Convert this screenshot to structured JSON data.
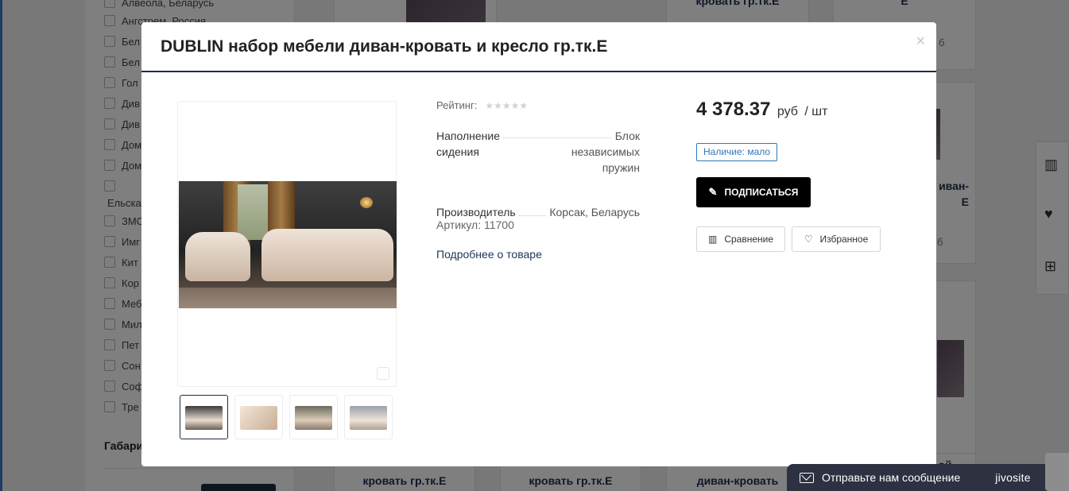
{
  "background": {
    "filters": [
      {
        "label": "Алвеола, Беларусь"
      },
      {
        "label": "Ангстрем, Россия"
      },
      {
        "label": "Бел"
      },
      {
        "label": "Бел"
      },
      {
        "label": "Гол"
      },
      {
        "label": "Див"
      },
      {
        "label": "Див"
      },
      {
        "label": "Дом"
      },
      {
        "label": "Дом"
      },
      {
        "label": ""
      },
      {
        "label": "ЗМС"
      },
      {
        "label": "Имг"
      },
      {
        "label": "Кит"
      },
      {
        "label": "Кор"
      },
      {
        "label": "Меб"
      },
      {
        "label": "Мил"
      },
      {
        "label": "Пет"
      },
      {
        "label": "Сон"
      },
      {
        "label": "Соф"
      },
      {
        "label": "Тре"
      }
    ],
    "filter_plain": "Ельска",
    "section_title": "Габари",
    "cards": {
      "top_title_1": "кровать гр.тк.Е",
      "top_title_2": "Е",
      "top_price_1": "б",
      "right_title": "иван-\nЕ",
      "right_price": "б",
      "bottom_title_1": "кровать гр.тк.Е",
      "bottom_title_2": "кровать гр.тк.Е",
      "bottom_title_3": "диван-кровать",
      "bottom_title_4": "ой"
    }
  },
  "modal": {
    "title": "DUBLIN набор мебели диван-кровать и кресло гр.тк.Е",
    "close": "×",
    "rating_label": "Рейтинг:",
    "rating_stars": "★★★★★",
    "rating_value": 0,
    "properties": {
      "filling_name": "Наполнение сидения",
      "filling_value": "Блок независимых пружин",
      "manufacturer_name": "Производитель",
      "manufacturer_value": "Корсак, Беларусь"
    },
    "article": "Артикул: 11700",
    "more_link": "Подробнее о товаре",
    "price": {
      "amount": "4 378.37",
      "currency": "руб",
      "unit": "/ шт"
    },
    "stock": "Наличие: мало",
    "subscribe_label": "ПОДПИСАТЬСЯ",
    "compare_label": "Сравнение",
    "favorite_label": "Избранное",
    "thumbnail_count": 4,
    "active_thumbnail": 1
  },
  "chat": {
    "text": "Отправьте нам сообщение",
    "brand": "jivosite"
  },
  "colors": {
    "accent_dark": "#1d2e44",
    "stock_blue": "#2f78b8",
    "chat_bg": "#2d3141"
  }
}
